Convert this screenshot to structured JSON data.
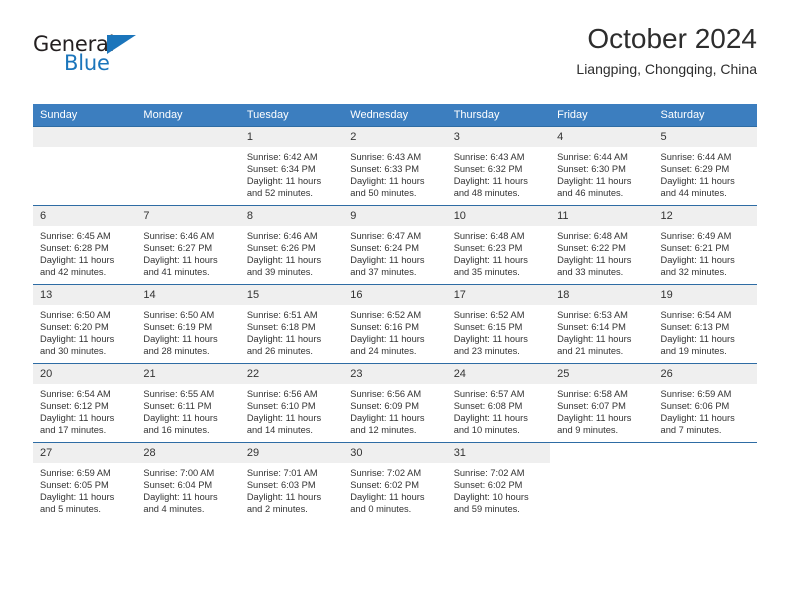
{
  "brand": {
    "name_part1": "General",
    "name_part2": "Blue",
    "triangle_color": "#1b75bb"
  },
  "header": {
    "title": "October 2024",
    "location": "Liangping, Chongqing, China"
  },
  "theme": {
    "header_blue": "#3c7ebf",
    "row_divider_blue": "#2e6ca4",
    "daynum_band": "#efefef",
    "text": "#333333"
  },
  "calendar": {
    "weekdays": [
      "Sunday",
      "Monday",
      "Tuesday",
      "Wednesday",
      "Thursday",
      "Friday",
      "Saturday"
    ],
    "weeks": [
      [
        {
          "day": "",
          "empty": true
        },
        {
          "day": "",
          "empty": true
        },
        {
          "day": "1",
          "sunrise": "Sunrise: 6:42 AM",
          "sunset": "Sunset: 6:34 PM",
          "daylight1": "Daylight: 11 hours",
          "daylight2": "and 52 minutes."
        },
        {
          "day": "2",
          "sunrise": "Sunrise: 6:43 AM",
          "sunset": "Sunset: 6:33 PM",
          "daylight1": "Daylight: 11 hours",
          "daylight2": "and 50 minutes."
        },
        {
          "day": "3",
          "sunrise": "Sunrise: 6:43 AM",
          "sunset": "Sunset: 6:32 PM",
          "daylight1": "Daylight: 11 hours",
          "daylight2": "and 48 minutes."
        },
        {
          "day": "4",
          "sunrise": "Sunrise: 6:44 AM",
          "sunset": "Sunset: 6:30 PM",
          "daylight1": "Daylight: 11 hours",
          "daylight2": "and 46 minutes."
        },
        {
          "day": "5",
          "sunrise": "Sunrise: 6:44 AM",
          "sunset": "Sunset: 6:29 PM",
          "daylight1": "Daylight: 11 hours",
          "daylight2": "and 44 minutes."
        }
      ],
      [
        {
          "day": "6",
          "sunrise": "Sunrise: 6:45 AM",
          "sunset": "Sunset: 6:28 PM",
          "daylight1": "Daylight: 11 hours",
          "daylight2": "and 42 minutes."
        },
        {
          "day": "7",
          "sunrise": "Sunrise: 6:46 AM",
          "sunset": "Sunset: 6:27 PM",
          "daylight1": "Daylight: 11 hours",
          "daylight2": "and 41 minutes."
        },
        {
          "day": "8",
          "sunrise": "Sunrise: 6:46 AM",
          "sunset": "Sunset: 6:26 PM",
          "daylight1": "Daylight: 11 hours",
          "daylight2": "and 39 minutes."
        },
        {
          "day": "9",
          "sunrise": "Sunrise: 6:47 AM",
          "sunset": "Sunset: 6:24 PM",
          "daylight1": "Daylight: 11 hours",
          "daylight2": "and 37 minutes."
        },
        {
          "day": "10",
          "sunrise": "Sunrise: 6:48 AM",
          "sunset": "Sunset: 6:23 PM",
          "daylight1": "Daylight: 11 hours",
          "daylight2": "and 35 minutes."
        },
        {
          "day": "11",
          "sunrise": "Sunrise: 6:48 AM",
          "sunset": "Sunset: 6:22 PM",
          "daylight1": "Daylight: 11 hours",
          "daylight2": "and 33 minutes."
        },
        {
          "day": "12",
          "sunrise": "Sunrise: 6:49 AM",
          "sunset": "Sunset: 6:21 PM",
          "daylight1": "Daylight: 11 hours",
          "daylight2": "and 32 minutes."
        }
      ],
      [
        {
          "day": "13",
          "sunrise": "Sunrise: 6:50 AM",
          "sunset": "Sunset: 6:20 PM",
          "daylight1": "Daylight: 11 hours",
          "daylight2": "and 30 minutes."
        },
        {
          "day": "14",
          "sunrise": "Sunrise: 6:50 AM",
          "sunset": "Sunset: 6:19 PM",
          "daylight1": "Daylight: 11 hours",
          "daylight2": "and 28 minutes."
        },
        {
          "day": "15",
          "sunrise": "Sunrise: 6:51 AM",
          "sunset": "Sunset: 6:18 PM",
          "daylight1": "Daylight: 11 hours",
          "daylight2": "and 26 minutes."
        },
        {
          "day": "16",
          "sunrise": "Sunrise: 6:52 AM",
          "sunset": "Sunset: 6:16 PM",
          "daylight1": "Daylight: 11 hours",
          "daylight2": "and 24 minutes."
        },
        {
          "day": "17",
          "sunrise": "Sunrise: 6:52 AM",
          "sunset": "Sunset: 6:15 PM",
          "daylight1": "Daylight: 11 hours",
          "daylight2": "and 23 minutes."
        },
        {
          "day": "18",
          "sunrise": "Sunrise: 6:53 AM",
          "sunset": "Sunset: 6:14 PM",
          "daylight1": "Daylight: 11 hours",
          "daylight2": "and 21 minutes."
        },
        {
          "day": "19",
          "sunrise": "Sunrise: 6:54 AM",
          "sunset": "Sunset: 6:13 PM",
          "daylight1": "Daylight: 11 hours",
          "daylight2": "and 19 minutes."
        }
      ],
      [
        {
          "day": "20",
          "sunrise": "Sunrise: 6:54 AM",
          "sunset": "Sunset: 6:12 PM",
          "daylight1": "Daylight: 11 hours",
          "daylight2": "and 17 minutes."
        },
        {
          "day": "21",
          "sunrise": "Sunrise: 6:55 AM",
          "sunset": "Sunset: 6:11 PM",
          "daylight1": "Daylight: 11 hours",
          "daylight2": "and 16 minutes."
        },
        {
          "day": "22",
          "sunrise": "Sunrise: 6:56 AM",
          "sunset": "Sunset: 6:10 PM",
          "daylight1": "Daylight: 11 hours",
          "daylight2": "and 14 minutes."
        },
        {
          "day": "23",
          "sunrise": "Sunrise: 6:56 AM",
          "sunset": "Sunset: 6:09 PM",
          "daylight1": "Daylight: 11 hours",
          "daylight2": "and 12 minutes."
        },
        {
          "day": "24",
          "sunrise": "Sunrise: 6:57 AM",
          "sunset": "Sunset: 6:08 PM",
          "daylight1": "Daylight: 11 hours",
          "daylight2": "and 10 minutes."
        },
        {
          "day": "25",
          "sunrise": "Sunrise: 6:58 AM",
          "sunset": "Sunset: 6:07 PM",
          "daylight1": "Daylight: 11 hours",
          "daylight2": "and 9 minutes."
        },
        {
          "day": "26",
          "sunrise": "Sunrise: 6:59 AM",
          "sunset": "Sunset: 6:06 PM",
          "daylight1": "Daylight: 11 hours",
          "daylight2": "and 7 minutes."
        }
      ],
      [
        {
          "day": "27",
          "sunrise": "Sunrise: 6:59 AM",
          "sunset": "Sunset: 6:05 PM",
          "daylight1": "Daylight: 11 hours",
          "daylight2": "and 5 minutes."
        },
        {
          "day": "28",
          "sunrise": "Sunrise: 7:00 AM",
          "sunset": "Sunset: 6:04 PM",
          "daylight1": "Daylight: 11 hours",
          "daylight2": "and 4 minutes."
        },
        {
          "day": "29",
          "sunrise": "Sunrise: 7:01 AM",
          "sunset": "Sunset: 6:03 PM",
          "daylight1": "Daylight: 11 hours",
          "daylight2": "and 2 minutes."
        },
        {
          "day": "30",
          "sunrise": "Sunrise: 7:02 AM",
          "sunset": "Sunset: 6:02 PM",
          "daylight1": "Daylight: 11 hours",
          "daylight2": "and 0 minutes."
        },
        {
          "day": "31",
          "sunrise": "Sunrise: 7:02 AM",
          "sunset": "Sunset: 6:02 PM",
          "daylight1": "Daylight: 10 hours",
          "daylight2": "and 59 minutes."
        },
        {
          "day": "",
          "empty": true,
          "blank": true
        },
        {
          "day": "",
          "empty": true,
          "blank": true
        }
      ]
    ]
  }
}
